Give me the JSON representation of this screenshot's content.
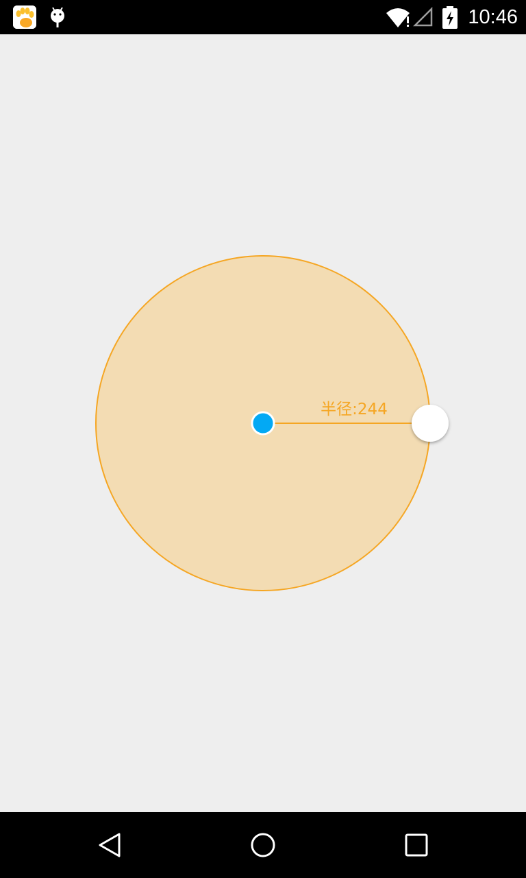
{
  "status_bar": {
    "time": "10:46",
    "notification_icons": [
      "paw-app-icon",
      "android-icon"
    ],
    "system_icons": [
      "wifi-alert-icon",
      "cell-signal-empty-icon",
      "battery-charging-icon"
    ]
  },
  "canvas": {
    "radius_label": "半径:244",
    "radius_value": 244,
    "colors": {
      "circle_fill": "#f3dcb3",
      "circle_stroke": "#f5a623",
      "radius_line": "#f5a623",
      "label_text": "#f5a623",
      "center_dot": "#03a9f4",
      "handle": "#ffffff"
    }
  },
  "nav_bar": {
    "buttons": [
      "back-icon",
      "home-icon",
      "recents-icon"
    ]
  }
}
